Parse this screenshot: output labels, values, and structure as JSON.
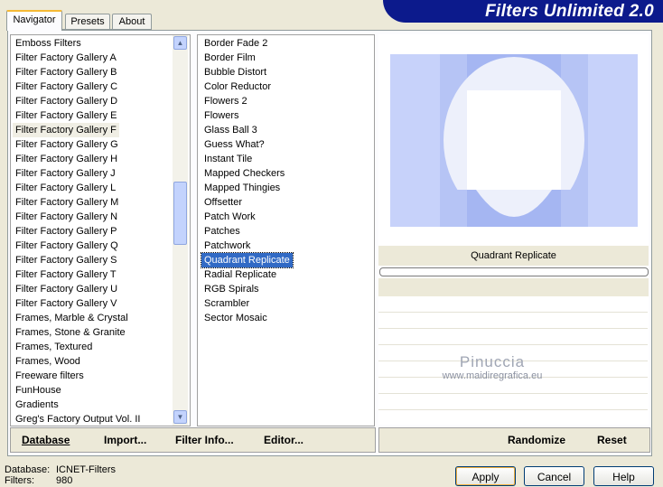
{
  "tabs": [
    "Navigator",
    "Presets",
    "About"
  ],
  "banner": "Filters Unlimited 2.0",
  "categories": [
    "Emboss Filters",
    "Filter Factory Gallery A",
    "Filter Factory Gallery B",
    "Filter Factory Gallery C",
    "Filter Factory Gallery D",
    "Filter Factory Gallery E",
    "Filter Factory Gallery F",
    "Filter Factory Gallery G",
    "Filter Factory Gallery H",
    "Filter Factory Gallery J",
    "Filter Factory Gallery L",
    "Filter Factory Gallery M",
    "Filter Factory Gallery N",
    "Filter Factory Gallery P",
    "Filter Factory Gallery Q",
    "Filter Factory Gallery S",
    "Filter Factory Gallery T",
    "Filter Factory Gallery U",
    "Filter Factory Gallery V",
    "Frames, Marble & Crystal",
    "Frames, Stone & Granite",
    "Frames, Textured",
    "Frames, Wood",
    "Freeware filters",
    "FunHouse",
    "Gradients",
    "Greg's Factory Output Vol. II"
  ],
  "selected_category_index": 6,
  "filters": [
    "Border Fade 2",
    "Border Film",
    "Bubble Distort",
    "Color Reductor",
    "Flowers 2",
    "Flowers",
    "Glass Ball 3",
    "Guess What?",
    "Instant Tile",
    "Mapped Checkers",
    "Mapped Thingies",
    "Offsetter",
    "Patch Work",
    "Patches",
    "Patchwork",
    "Quadrant Replicate",
    "Radial Replicate",
    "RGB Spirals",
    "Scrambler",
    "Sector Mosaic"
  ],
  "selected_filter_index": 15,
  "preview": {
    "filter_name": "Quadrant Replicate",
    "watermark_name": "Pinuccia",
    "watermark_url": "www.maidiregrafica.eu"
  },
  "toolbar": {
    "database": "Database",
    "import": "Import...",
    "filter_info": "Filter Info...",
    "editor": "Editor...",
    "randomize": "Randomize",
    "reset": "Reset"
  },
  "status": {
    "db_label": "Database:",
    "db_value": "ICNET-Filters",
    "filters_label": "Filters:",
    "filters_value": "980"
  },
  "buttons": {
    "apply": "Apply",
    "cancel": "Cancel",
    "help": "Help"
  },
  "colors": {
    "selection": "#316ac5",
    "banner": "#0c1a8c",
    "preview_light": "#c7d2fa",
    "preview_mid": "#a5b6f2"
  }
}
